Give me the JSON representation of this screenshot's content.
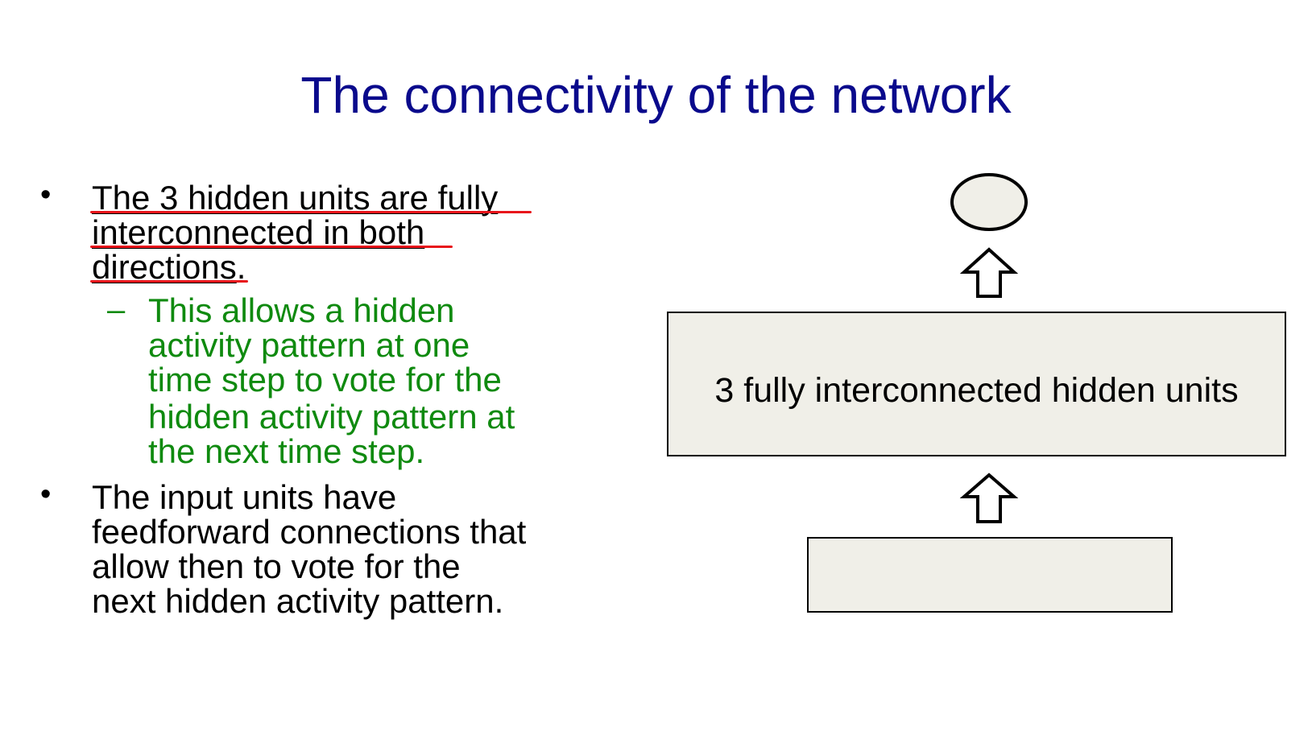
{
  "slide": {
    "title": "The connectivity of the network",
    "bullets": [
      {
        "lines": [
          "The 3 hidden units are fully",
          "interconnected in both",
          "directions"
        ],
        "trailing": "."
      },
      {
        "lines": [
          "The input units have",
          "feedforward connections that",
          "allow then to vote for the",
          "next hidden activity pattern."
        ]
      }
    ],
    "sub_bullet": {
      "dash": "–",
      "lines": [
        "This allows a hidden",
        "activity pattern at one",
        "time step to vote for the",
        "hidden activity pattern at",
        "the next time step."
      ]
    },
    "bullet_symbol": "•"
  },
  "diagram": {
    "hidden_box_label": "3 fully interconnected hidden units",
    "box_fill": "#f0efe8",
    "underline_color": "#e8151b",
    "title_color": "#0a0a8c",
    "sub_color": "#0f8a0f"
  }
}
